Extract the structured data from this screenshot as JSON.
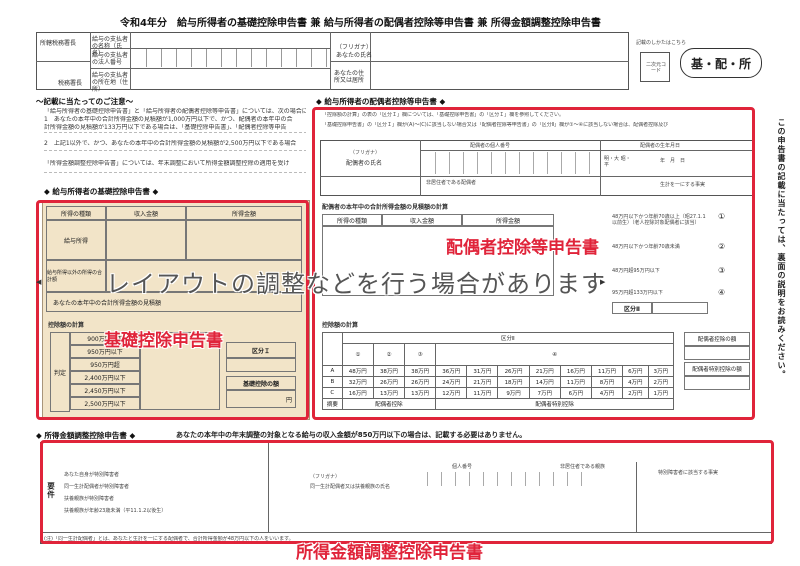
{
  "header": {
    "title": "令和4年分　給与所得者の基礎控除申告書 兼 給与所得者の配偶者控除等申告書 兼 所得金額調整控除申告書",
    "office_label": "所轄税務署長",
    "tax_office_label": "税務署長",
    "payer_name_label": "給与の支払者の名称（氏名）",
    "payer_number_label": "給与の支払者の法人番号",
    "payer_address_label": "給与の支払者の所在地（住所）",
    "furigana_label": "（フリガナ）",
    "your_name_label": "あなたの氏名",
    "your_address_label": "あなたの住所又は居所",
    "seal_note": "記載のしかたはこちら",
    "code_label": "二次元コード",
    "badge": "基・配・所"
  },
  "notes": {
    "title": "〜記載に当たってのご注意〜",
    "lines": [
      "「給与所得者の基礎控除申告書」と「給与所得者の配偶者控除等申告書」については、次の場合に記載してください。",
      "1　あなたの本年中の合計所得金額の見積額が1,000万円以下で、かつ、配偶者の本年中の合",
      "計所得金額の見積額が133万円以下である場合は、「基礎控除申告書」、「配偶者控除等申告",
      "2　上記1以外で、かつ、あなたの本年中の合計所得金額の見積額が2,500万円以下である場合",
      "「所得金額調整控除申告書」については、年末調整において所得金額調整控除の適用を受け"
    ]
  },
  "basic": {
    "title": "◆ 給与所得者の基礎控除申告書 ◆",
    "col_type": "所得の種類",
    "col_income": "収入金額",
    "col_amount": "所得金額",
    "row1": "給与所得",
    "row2": "給与所得以外の所得の合計額",
    "total_label": "あなたの本年中の合計所得金額の見積額",
    "calc_title": "控除額の計算",
    "judge": "判定",
    "ranges": [
      "900万円以下",
      "950万円以下",
      "950万円超",
      "2,400万円以下",
      "2,450万円以下",
      "2,500万円以下"
    ],
    "class_label": "区分Ｉ",
    "deduction_label": "基礎控除の額",
    "unit": "円"
  },
  "spouse": {
    "title": "◆ 給与所得者の配偶者控除等申告書 ◆",
    "instr1": "「控除額の計算」の表の「区分Ｉ」欄については、「基礎控除申告書」の「区分Ｉ」欄を参照してください。",
    "instr2": "「基礎控除申告書」の「区分Ｉ」欄が(A)〜(C)に該当しない場合又は「配偶者控除等申告書」の「区分Ⅱ」欄が①〜④に該当しない場合は、配偶者控除及び",
    "spouse_name_label": "配偶者の氏名",
    "furigana": "（フリガナ）",
    "number_label": "配偶者の個人番号",
    "birth_label": "配偶者の生年月日",
    "era": "明・大 昭・平",
    "ymd": "年　月　日",
    "nonresident": "非居住者である配偶者",
    "livelihood": "生計を一にする事実",
    "income_title": "配偶者の本年中の合計所得金額の見積額の計算",
    "col_type": "所得の種類",
    "col_income": "収入金額",
    "col_amount": "所得金額",
    "choices": [
      "48万円以下かつ年齢70歳以上（昭27.1.1以前生）（老人控除対象配偶者に該当）",
      "48万円以下かつ年齢70歳未満",
      "48万円超95万円以下",
      "95万円超133万円以下"
    ],
    "choice_nums": [
      "①",
      "②",
      "③",
      "④"
    ],
    "class2": "区分Ⅱ",
    "calc_title": "控除額の計算",
    "class2_head": "区分Ⅱ",
    "col_heads": [
      "①",
      "②",
      "③"
    ],
    "class1": "区分Ｉ",
    "rows": [
      {
        "k": "A",
        "v": [
          "48万円",
          "38万円",
          "38万円",
          "36万円",
          "31万円",
          "26万円",
          "21万円",
          "16万円",
          "11万円",
          "6万円",
          "3万円"
        ]
      },
      {
        "k": "B",
        "v": [
          "32万円",
          "26万円",
          "26万円",
          "24万円",
          "21万円",
          "18万円",
          "14万円",
          "11万円",
          "8万円",
          "4万円",
          "2万円"
        ]
      },
      {
        "k": "C",
        "v": [
          "16万円",
          "13万円",
          "13万円",
          "12万円",
          "11万円",
          "9万円",
          "7万円",
          "6万円",
          "4万円",
          "2万円",
          "1万円"
        ]
      }
    ],
    "summary_head": "摘要",
    "deduction1": "配偶者控除",
    "deduction2": "配偶者特別控除",
    "amount_box1": "配偶者控除の額",
    "amount_box2": "配偶者特別控除の額"
  },
  "adjust": {
    "title": "◆ 所得金額調整控除申告書 ◆",
    "subtitle": "あなたの本年中の年末調整の対象となる給与の収入金額が850万円以下の場合は、記載する必要はありません。",
    "req_label": "要件",
    "items": [
      "あなた自身が特別障害者",
      "同一生計配偶者が特別障害者",
      "扶養親族が特別障害者",
      "扶養親族が年齢23歳未満（平11.1.2以後生）"
    ],
    "furigana": "（フリガナ）",
    "name_label": "同一生計配偶者又は扶養親族の氏名",
    "number_label": "個人番号",
    "nonresident": "非居住者である親族",
    "special_label": "特別障害者に該当する事実",
    "footnote": "(注)「同一生計配偶者」とは、あなたと生計を一にする配偶者で、合計所得金額が48万円以下の人をいいます。"
  },
  "overlay": {
    "watermark": "レイアウトの調整などを行う場合があります",
    "label_basic": "基礎控除申告書",
    "label_spouse": "配偶者控除等申告書",
    "label_adjust": "所得金額調整控除申告書",
    "side_note": "この申告書の記載に当たっては、裏面の説明をお読みください。"
  },
  "colors": {
    "red": "#e0243a",
    "tan": "#f2e4c8"
  }
}
